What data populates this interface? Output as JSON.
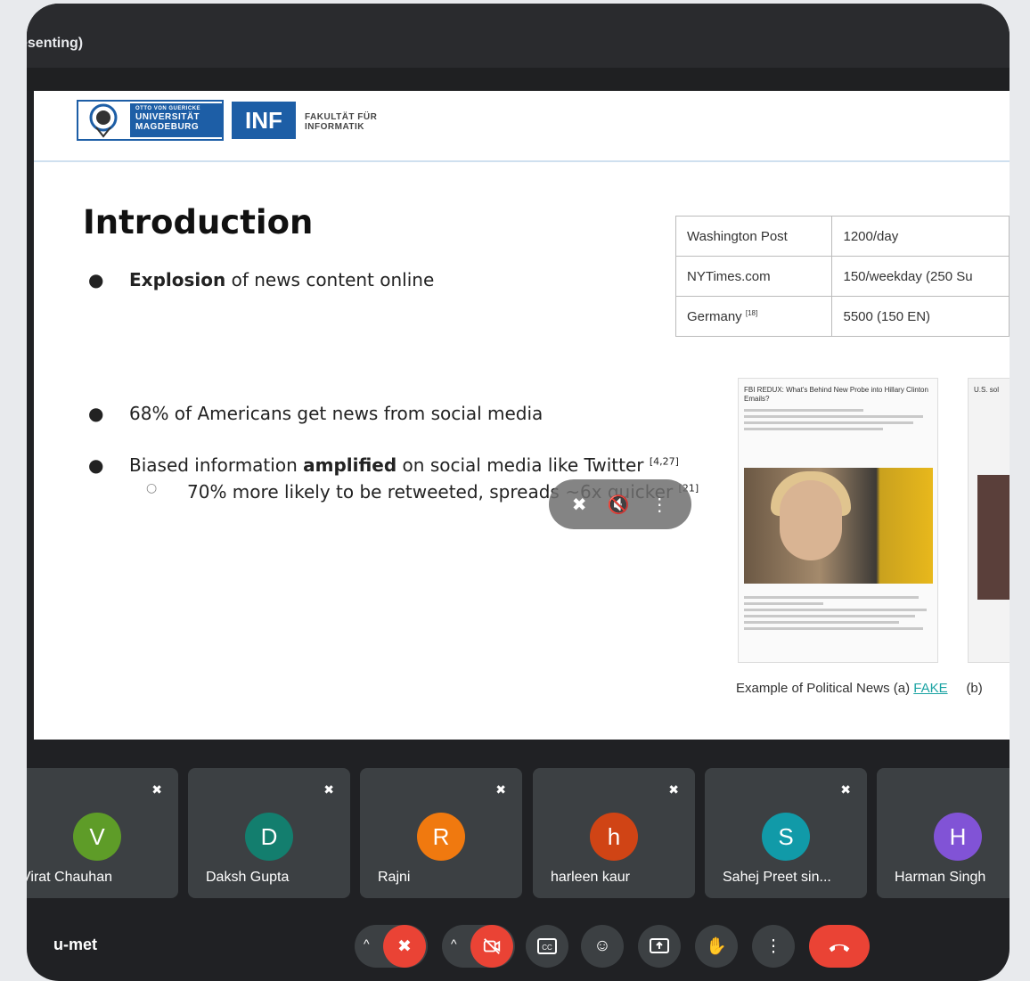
{
  "window": {
    "title_fragment": "esenting)"
  },
  "slide": {
    "logos": {
      "ovgu_top": "OTTO VON GUERICKE",
      "ovgu_line1": "UNIVERSITÄT",
      "ovgu_line2": "MAGDEBURG",
      "inf": "INF",
      "fak_line1": "FAKULTÄT FÜR",
      "fak_line2": "INFORMATIK"
    },
    "title": "Introduction",
    "bullets": [
      {
        "bold": "Explosion",
        "text": " of news content online"
      },
      {
        "text": "68% of Americans get news from social media"
      },
      {
        "pre": "Biased information ",
        "bold": "amplified",
        "text": " on social media like Twitter ",
        "ref": "[4,27]"
      },
      {
        "text": "70% more likely to be retweeted, spreads ~6x quicker ",
        "ref": "[21]"
      }
    ],
    "table": [
      {
        "source": "Washington Post",
        "ref": "",
        "rate": "1200/day"
      },
      {
        "source": "NYTimes.com",
        "ref": "",
        "rate": "150/weekday (250 Su"
      },
      {
        "source": "Germany ",
        "ref": "[18]",
        "rate": "5500 (150 EN)"
      }
    ],
    "article_a_headline": "FBI REDUX: What's Behind New Probe into Hillary Clinton Emails?",
    "article_b_headline": "U.S. sol",
    "caption": {
      "text": "Example of Political News (a) ",
      "link": "FAKE",
      "tail": "(b)"
    }
  },
  "participants": [
    {
      "initial": "V",
      "name": "Virat Chauhan",
      "color": "#5e9c28"
    },
    {
      "initial": "D",
      "name": "Daksh Gupta",
      "color": "#137e6e"
    },
    {
      "initial": "R",
      "name": "Rajni",
      "color": "#f0790f"
    },
    {
      "initial": "h",
      "name": "harleen kaur",
      "color": "#d04415"
    },
    {
      "initial": "S",
      "name": "Sahej Preet sin...",
      "color": "#119aa8"
    },
    {
      "initial": "H",
      "name": "Harman Singh",
      "color": "#8153d6"
    }
  ],
  "meeting": {
    "code_fragment": "u-met"
  },
  "colors": {
    "hangup": "#ea4335",
    "background": "#202124",
    "tile": "#3c4043"
  }
}
